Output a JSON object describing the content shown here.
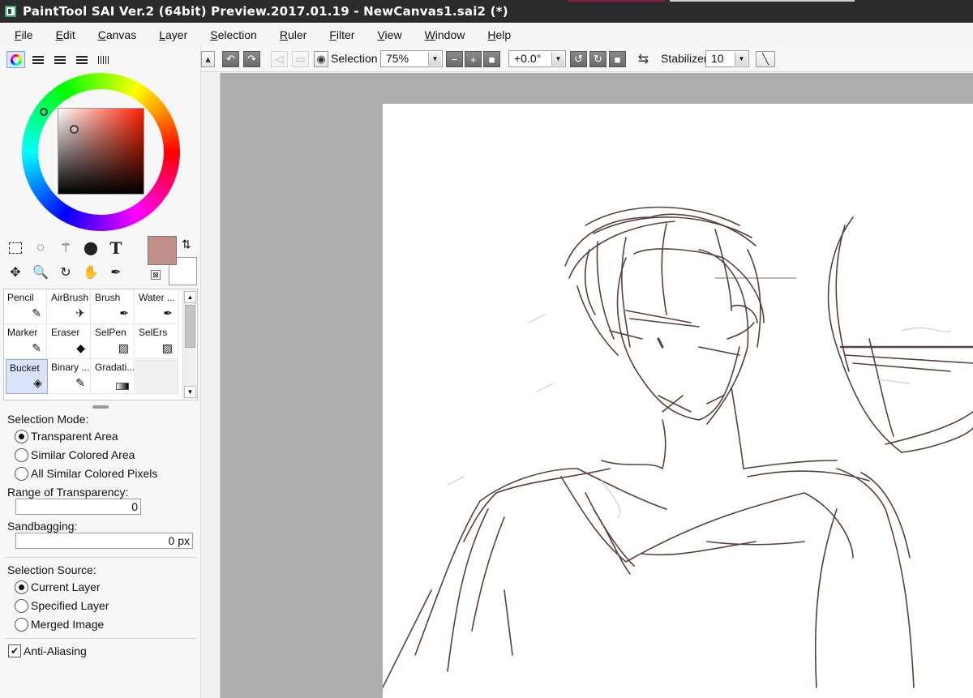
{
  "window": {
    "title": "PaintTool SAI Ver.2 (64bit) Preview.2017.01.19 - NewCanvas1.sai2 (*)"
  },
  "menu": [
    "File",
    "Edit",
    "Canvas",
    "Layer",
    "Selection",
    "Ruler",
    "Filter",
    "View",
    "Window",
    "Help"
  ],
  "color_panel": {
    "foreground_color": "#c2908a",
    "background_color": "#ffffff"
  },
  "brushes": [
    {
      "label": "Pencil",
      "icon": "pencil-icon",
      "glyph": "✎"
    },
    {
      "label": "AirBrush",
      "icon": "airbrush-icon",
      "glyph": "✈"
    },
    {
      "label": "Brush",
      "icon": "brush-icon",
      "glyph": "🖌"
    },
    {
      "label": "Water ...",
      "icon": "water-icon",
      "glyph": "💧"
    },
    {
      "label": "Marker",
      "icon": "marker-icon",
      "glyph": "✎"
    },
    {
      "label": "Eraser",
      "icon": "eraser-icon",
      "glyph": "◆"
    },
    {
      "label": "SelPen",
      "icon": "selpen-icon",
      "glyph": "▨"
    },
    {
      "label": "SelErs",
      "icon": "selers-icon",
      "glyph": "▨"
    },
    {
      "label": "Bucket",
      "icon": "bucket-icon",
      "glyph": "◈"
    },
    {
      "label": "Binary ...",
      "icon": "binary-pen-icon",
      "glyph": "✎"
    },
    {
      "label": "Gradati...",
      "icon": "gradation-icon",
      "glyph": "▬"
    }
  ],
  "active_brush": "Bucket",
  "options": {
    "selection_mode_label": "Selection Mode:",
    "selection_modes": [
      "Transparent Area",
      "Similar Colored Area",
      "All Similar Colored Pixels"
    ],
    "selection_mode_selected": 0,
    "range_label": "Range of Transparency:",
    "range_value": "0",
    "sandbagging_label": "Sandbagging:",
    "sandbagging_value": "0 px",
    "source_label": "Selection Source:",
    "sources": [
      "Current Layer",
      "Specified Layer",
      "Merged Image"
    ],
    "source_selected": 0,
    "anti_aliasing_label": "Anti-Aliasing",
    "anti_aliasing": true
  },
  "toolbar": {
    "selection_label": "Selection",
    "zoom": "75%",
    "rotation": "+0.0°",
    "stabilizer_label": "Stabilizer",
    "stabilizer_value": "10"
  }
}
